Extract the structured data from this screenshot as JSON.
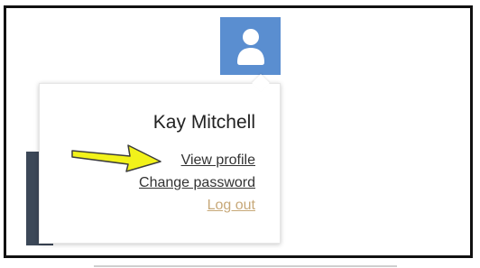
{
  "user_menu": {
    "avatar_icon": "user-icon",
    "user_name": "Kay Mitchell",
    "view_profile_label": "View profile",
    "change_password_label": "Change password",
    "logout_label": "Log out"
  },
  "annotation": {
    "arrow_icon": "arrow-right-icon",
    "arrow_color": "#f2f21a"
  },
  "colors": {
    "avatar_bg": "#5a8ed0",
    "logout_link": "#c7a878",
    "dark_panel": "#3c4858"
  }
}
